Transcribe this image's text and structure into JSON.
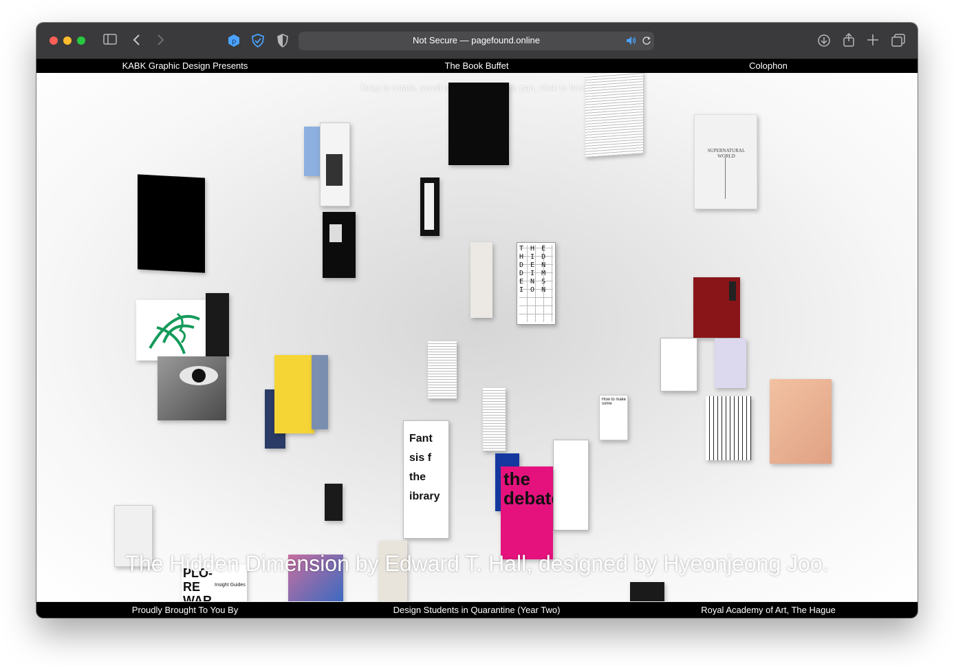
{
  "browser": {
    "address": "Not Secure — pagefound.online"
  },
  "nav": {
    "left": "KABK Graphic Design Presents",
    "center": "The Book Buffet",
    "right": "Colophon"
  },
  "hint": "Drag to rotate, scroll to zoom, arrows to pan, click to focus.",
  "books": {
    "supernatural": "SUPERNATURAL WORLD",
    "fantasies": "Fant sis f the ibrary",
    "debate": "the debate",
    "plo": "PLO- RE WAR",
    "plo_sub": "Insight Guides",
    "howto": "How to make some",
    "hidden_letters": "T H E H I D D E N D I M E N S I O N",
    "hidden_spine": "The Hidden Dimension"
  },
  "caption": "The Hidden Dimension by Edward T. Hall, designed by Hyeonjeong Joo.",
  "footer": {
    "left": "Proudly Brought To You By",
    "center": "Design Students in Quarantine (Year Two)",
    "right": "Royal Academy of Art, The Hague"
  },
  "colors": {
    "close": "#ff5f57",
    "minimize": "#febc2e",
    "zoom": "#28c840",
    "extension_blue": "#4aa3ff",
    "debate_pink": "#e5127e",
    "yellow": "#f5d536",
    "red_book": "#8a1518"
  }
}
